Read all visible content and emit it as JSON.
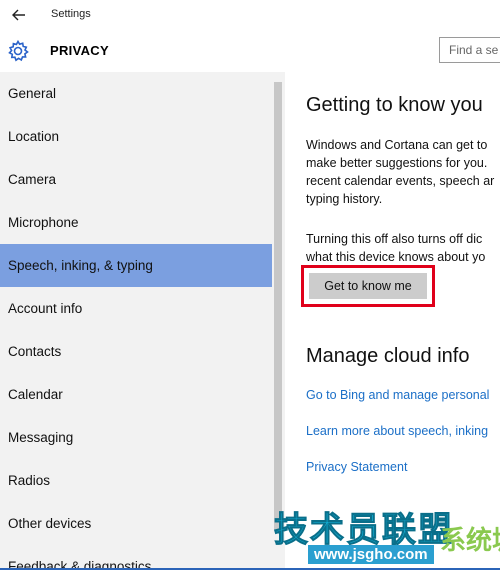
{
  "window": {
    "app_title": "Settings",
    "back_icon": "back-arrow-icon"
  },
  "header": {
    "icon": "gear-icon",
    "title": "PRIVACY",
    "search_placeholder": "Find a se"
  },
  "sidebar": {
    "items": [
      {
        "label": "General",
        "active": false
      },
      {
        "label": "Location",
        "active": false
      },
      {
        "label": "Camera",
        "active": false
      },
      {
        "label": "Microphone",
        "active": false
      },
      {
        "label": "Speech, inking, & typing",
        "active": true
      },
      {
        "label": "Account info",
        "active": false
      },
      {
        "label": "Contacts",
        "active": false
      },
      {
        "label": "Calendar",
        "active": false
      },
      {
        "label": "Messaging",
        "active": false
      },
      {
        "label": "Radios",
        "active": false
      },
      {
        "label": "Other devices",
        "active": false
      },
      {
        "label": "Feedback & diagnostics",
        "active": false
      }
    ],
    "active_color": "#7b9fe0"
  },
  "main": {
    "section1_title": "Getting to know you",
    "para1": [
      "Windows and Cortana can get to",
      "make better suggestions for you.",
      "recent calendar events, speech ar",
      "typing history."
    ],
    "para2": [
      "Turning this off also turns off dic",
      "what this device knows about yo"
    ],
    "button_label": "Get to know me",
    "highlight_color": "#e0001a",
    "section2_title": "Manage cloud info",
    "links": [
      "Go to Bing and manage personal",
      "Learn more about speech, inking",
      "Privacy Statement"
    ],
    "link_color": "#1b6fc7"
  },
  "watermark": {
    "big_text": "技术员联盟",
    "side_text": "系统城",
    "url": "www.jsgho.com"
  }
}
